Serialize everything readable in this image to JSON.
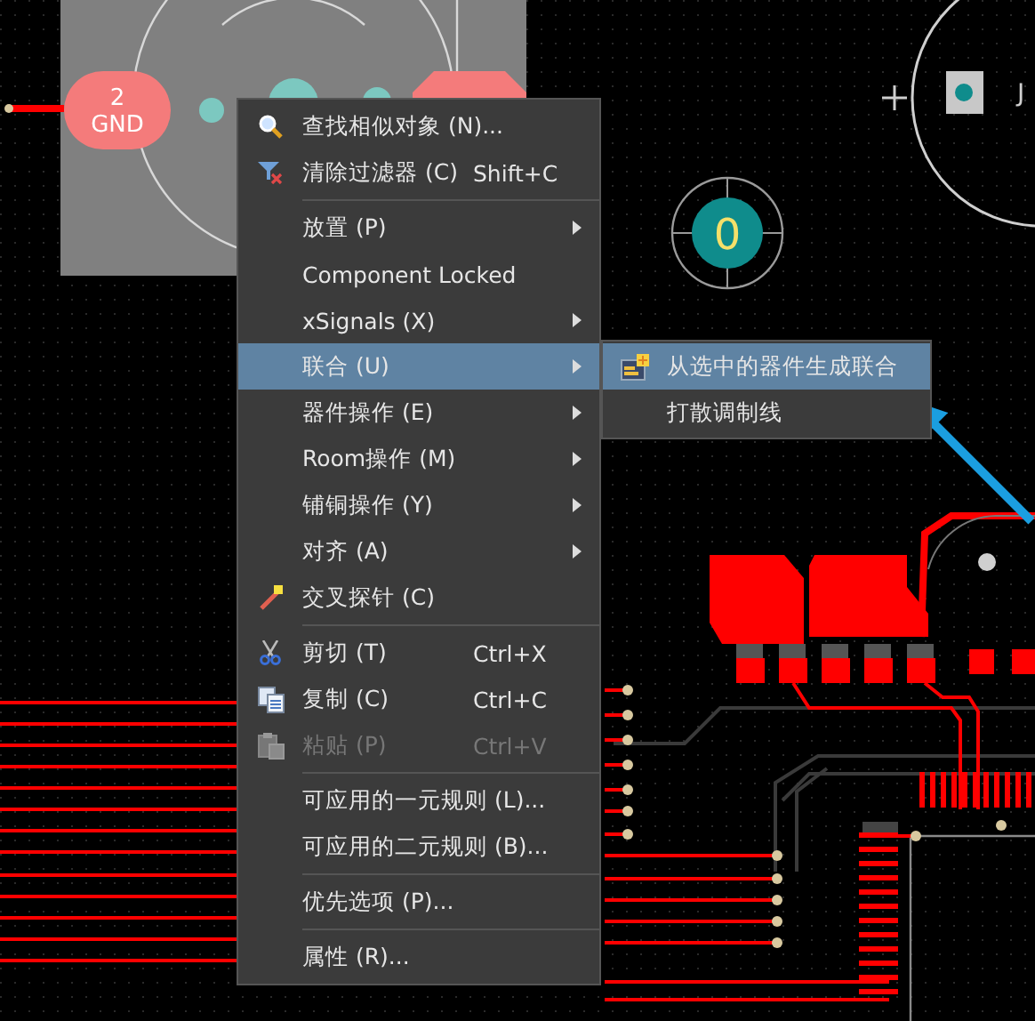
{
  "board": {
    "pads": [
      {
        "kind": "oval",
        "number": "2",
        "net": "GND"
      },
      {
        "kind": "octagon"
      },
      {
        "kind": "round",
        "number": "0"
      }
    ],
    "designator_fragment": "J"
  },
  "context_menu": {
    "groups": [
      [
        {
          "kind": "command",
          "label": "查找相似对象 (N)...",
          "selected": false,
          "disabled": false
        },
        {
          "kind": "command",
          "label": "清除过滤器 (C)",
          "shortcut": "Shift+C",
          "selected": false,
          "disabled": false
        }
      ],
      [
        {
          "kind": "submenu",
          "label": "放置 (P)",
          "selected": false,
          "disabled": false
        },
        {
          "kind": "command",
          "label": "Component Locked",
          "selected": false,
          "disabled": false
        },
        {
          "kind": "submenu",
          "label": "xSignals (X)",
          "selected": false,
          "disabled": false
        },
        {
          "kind": "submenu",
          "label": "联合 (U)",
          "selected": true,
          "disabled": false
        },
        {
          "kind": "submenu",
          "label": "器件操作 (E)",
          "selected": false,
          "disabled": false
        },
        {
          "kind": "submenu",
          "label": "Room操作 (M)",
          "selected": false,
          "disabled": false
        },
        {
          "kind": "submenu",
          "label": "铺铜操作 (Y)",
          "selected": false,
          "disabled": false
        },
        {
          "kind": "submenu",
          "label": "对齐 (A)",
          "selected": false,
          "disabled": false
        },
        {
          "kind": "command",
          "label": "交叉探针 (C)",
          "selected": false,
          "disabled": false
        }
      ],
      [
        {
          "kind": "command",
          "label": "剪切 (T)",
          "shortcut": "Ctrl+X",
          "selected": false,
          "disabled": false
        },
        {
          "kind": "command",
          "label": "复制 (C)",
          "shortcut": "Ctrl+C",
          "selected": false,
          "disabled": false
        },
        {
          "kind": "command",
          "label": "粘贴 (P)",
          "shortcut": "Ctrl+V",
          "selected": false,
          "disabled": true
        }
      ],
      [
        {
          "kind": "command",
          "label": "可应用的一元规则 (L)...",
          "selected": false,
          "disabled": false
        },
        {
          "kind": "command",
          "label": "可应用的二元规则 (B)...",
          "selected": false,
          "disabled": false
        }
      ],
      [
        {
          "kind": "command",
          "label": "优先选项 (P)...",
          "selected": false,
          "disabled": false
        }
      ],
      [
        {
          "kind": "command",
          "label": "属性 (R)...",
          "selected": false,
          "disabled": false
        }
      ]
    ]
  },
  "submenu": {
    "items": [
      {
        "label": "从选中的器件生成联合",
        "selected": true
      },
      {
        "label": "打散调制线",
        "selected": false
      }
    ]
  }
}
